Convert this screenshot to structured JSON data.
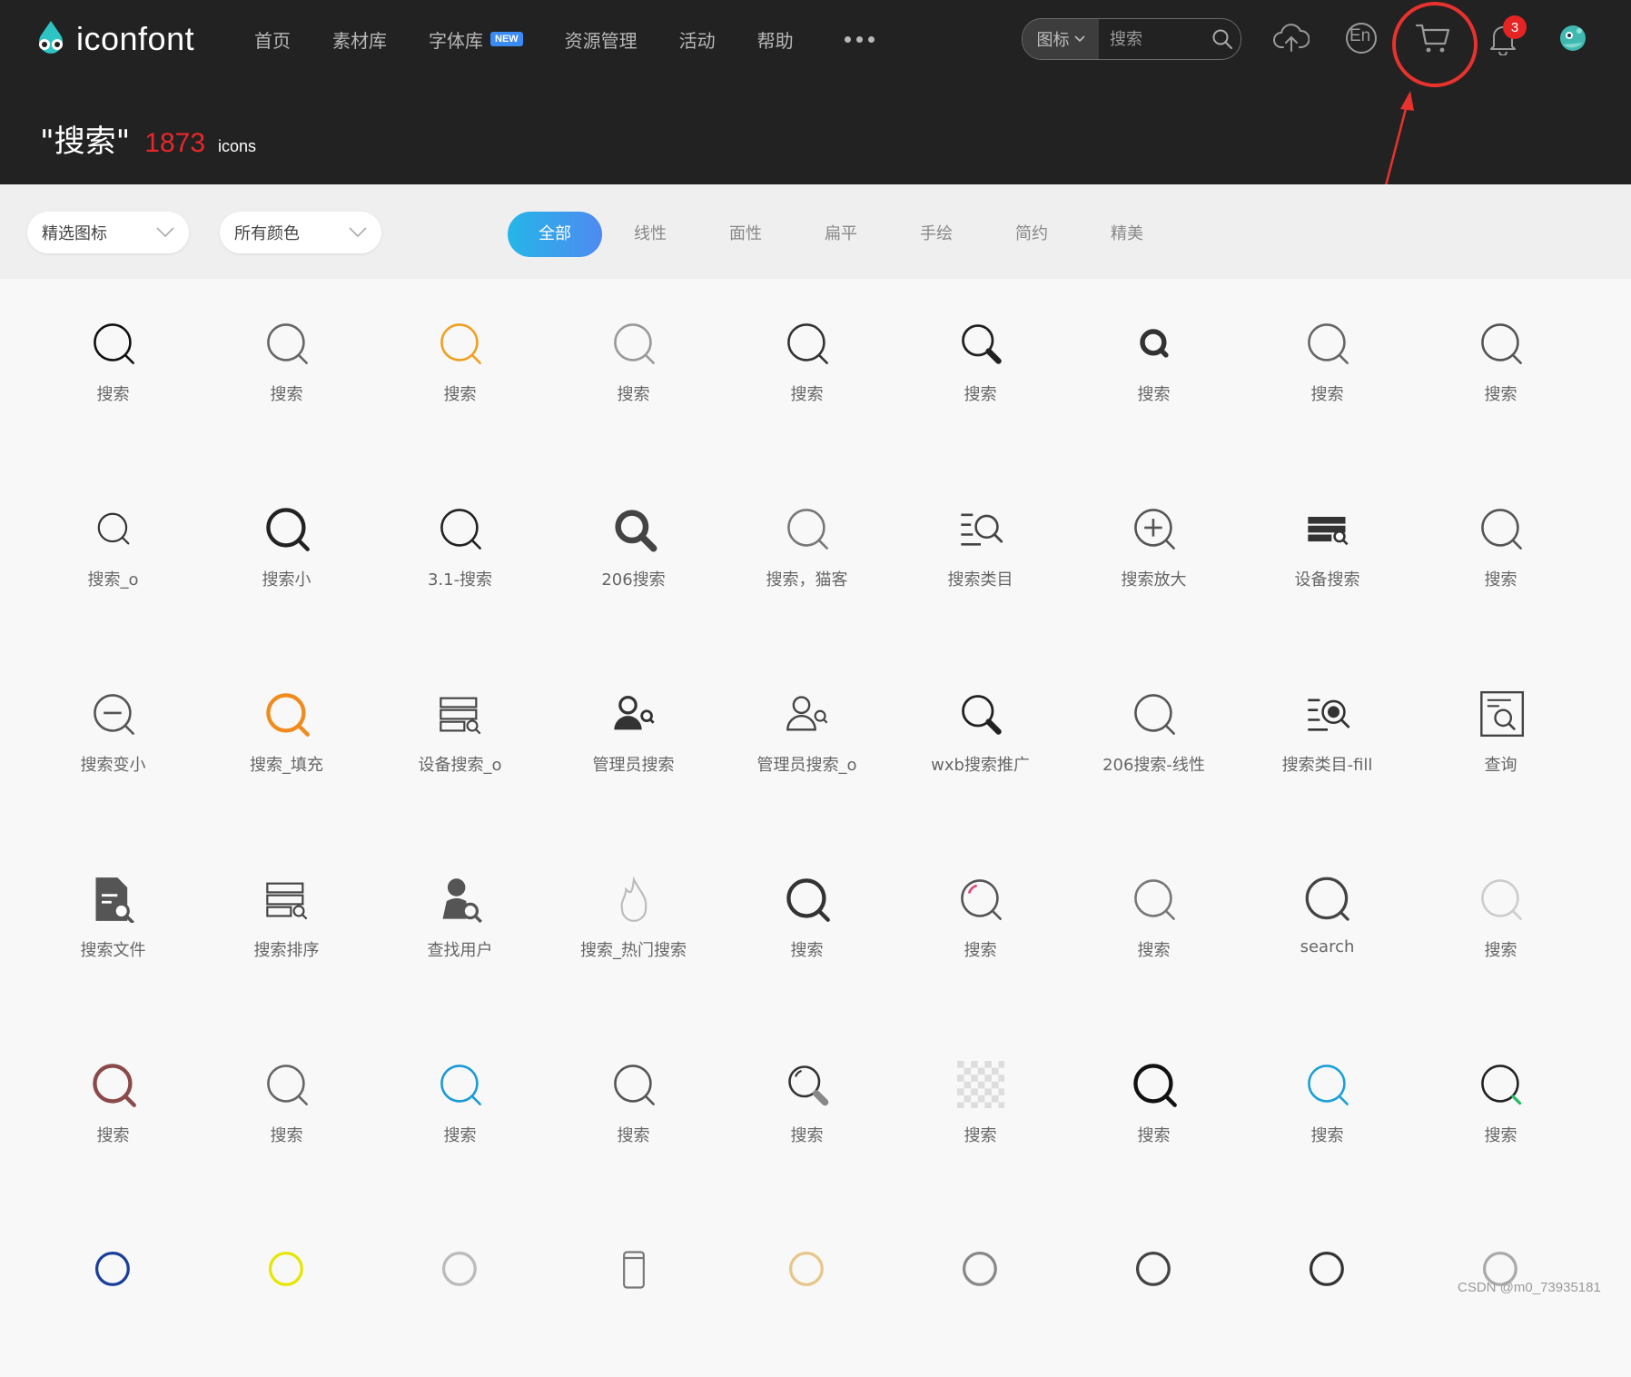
{
  "header": {
    "logo_text": "iconfont",
    "nav": [
      {
        "label": "首页",
        "badge": ""
      },
      {
        "label": "素材库",
        "badge": ""
      },
      {
        "label": "字体库",
        "badge": "NEW"
      },
      {
        "label": "资源管理",
        "badge": ""
      },
      {
        "label": "活动",
        "badge": ""
      },
      {
        "label": "帮助",
        "badge": ""
      }
    ],
    "more_icon": "more-dots-icon",
    "search": {
      "type_label": "图标",
      "placeholder": "搜索",
      "value": ""
    },
    "language_label": "En",
    "notification_count": "3",
    "icons": [
      "upload-cloud-icon",
      "language-icon",
      "cart-icon",
      "bell-icon",
      "avatar"
    ]
  },
  "result": {
    "query": "\"搜索\"",
    "count": "1873",
    "unit": "icons"
  },
  "filters": {
    "dropdowns": [
      "精选图标",
      "所有颜色"
    ],
    "tabs": [
      "全部",
      "线性",
      "面性",
      "扁平",
      "手绘",
      "简约",
      "精美"
    ],
    "active_tab": "全部"
  },
  "accent_colors": {
    "tab_gradient_start": "#25b6e8",
    "tab_gradient_end": "#4e8af0",
    "count_red": "#e7282b",
    "annotation_red": "#e8322d"
  },
  "icons": [
    {
      "label": "搜索",
      "kind": "mag",
      "color": "#111111"
    },
    {
      "label": "搜索",
      "kind": "mag",
      "color": "#666666"
    },
    {
      "label": "搜索",
      "kind": "mag",
      "color": "#f0a020"
    },
    {
      "label": "搜索",
      "kind": "mag",
      "color": "#999999"
    },
    {
      "label": "搜索",
      "kind": "mag",
      "color": "#333333"
    },
    {
      "label": "搜索",
      "kind": "mag-handle",
      "color": "#222222"
    },
    {
      "label": "搜索",
      "kind": "mag-bold-small",
      "color": "#333333"
    },
    {
      "label": "搜索",
      "kind": "mag",
      "color": "#666666"
    },
    {
      "label": "搜索",
      "kind": "mag",
      "color": "#555555"
    },
    {
      "label": "搜索_o",
      "kind": "mag-small",
      "color": "#333333"
    },
    {
      "label": "搜索小",
      "kind": "mag-bold",
      "color": "#222222"
    },
    {
      "label": "3.1-搜索",
      "kind": "mag",
      "color": "#222222"
    },
    {
      "label": "206搜索",
      "kind": "mag-filled",
      "color": "#444444"
    },
    {
      "label": "搜索，猫客",
      "kind": "mag",
      "color": "#777777"
    },
    {
      "label": "搜索类目",
      "kind": "list-search",
      "color": "#444444"
    },
    {
      "label": "搜索放大",
      "kind": "zoom-in",
      "color": "#555555"
    },
    {
      "label": "设备搜索",
      "kind": "server-search-filled",
      "color": "#333333"
    },
    {
      "label": "搜索",
      "kind": "mag",
      "color": "#555555"
    },
    {
      "label": "搜索变小",
      "kind": "zoom-out",
      "color": "#555555"
    },
    {
      "label": "搜索_填充",
      "kind": "mag-bold",
      "color": "#f08c1e"
    },
    {
      "label": "设备搜索_o",
      "kind": "server-search",
      "color": "#444444"
    },
    {
      "label": "管理员搜索",
      "kind": "user-search-filled",
      "color": "#333333"
    },
    {
      "label": "管理员搜索_o",
      "kind": "user-search",
      "color": "#444444"
    },
    {
      "label": "wxb搜索推广",
      "kind": "mag-handle",
      "color": "#222222"
    },
    {
      "label": "206搜索-线性",
      "kind": "mag",
      "color": "#555555"
    },
    {
      "label": "搜索类目-fill",
      "kind": "list-search-fill",
      "color": "#333333"
    },
    {
      "label": "查询",
      "kind": "doc-search",
      "color": "#444444"
    },
    {
      "label": "搜索文件",
      "kind": "file-search",
      "color": "#555555"
    },
    {
      "label": "搜索排序",
      "kind": "server-search",
      "color": "#444444"
    },
    {
      "label": "查找用户",
      "kind": "person-search",
      "color": "#555555"
    },
    {
      "label": "搜索_热门搜索",
      "kind": "flame",
      "color": "#bbbbbb"
    },
    {
      "label": "搜索",
      "kind": "mag-bold",
      "color": "#333333"
    },
    {
      "label": "搜索",
      "kind": "mag-pink",
      "color": "#555555"
    },
    {
      "label": "搜索",
      "kind": "mag",
      "color": "#777777"
    },
    {
      "label": "search",
      "kind": "mag-large",
      "color": "#444444"
    },
    {
      "label": "搜索",
      "kind": "mag",
      "color": "#cccccc"
    },
    {
      "label": "搜索",
      "kind": "mag-bold",
      "color": "#8b4a4a"
    },
    {
      "label": "搜索",
      "kind": "mag",
      "color": "#666666"
    },
    {
      "label": "搜索",
      "kind": "mag",
      "color": "#1a9ad6"
    },
    {
      "label": "搜索",
      "kind": "mag",
      "color": "#555555"
    },
    {
      "label": "搜索",
      "kind": "mag-grey-handle",
      "color": "#333333"
    },
    {
      "label": "搜索",
      "kind": "checker",
      "color": "#dddddd"
    },
    {
      "label": "搜索",
      "kind": "mag-bold",
      "color": "#111111"
    },
    {
      "label": "搜索",
      "kind": "mag",
      "color": "#1aa0d8"
    },
    {
      "label": "搜索",
      "kind": "mag-green",
      "color": "#222222"
    },
    {
      "label": "",
      "kind": "partial-mag",
      "color": "#1a3e9a"
    },
    {
      "label": "",
      "kind": "partial-mag",
      "color": "#e6e600"
    },
    {
      "label": "",
      "kind": "partial-mag",
      "color": "#bbbbbb"
    },
    {
      "label": "",
      "kind": "partial-phone",
      "color": "#777777"
    },
    {
      "label": "",
      "kind": "partial-mag",
      "color": "#e6c68a"
    },
    {
      "label": "",
      "kind": "partial-mag",
      "color": "#888888"
    },
    {
      "label": "",
      "kind": "partial-mag",
      "color": "#444444"
    },
    {
      "label": "",
      "kind": "partial-mag",
      "color": "#333333"
    },
    {
      "label": "",
      "kind": "partial-mag",
      "color": "#aaaaaa"
    }
  ],
  "watermark": "CSDN @m0_73935181"
}
